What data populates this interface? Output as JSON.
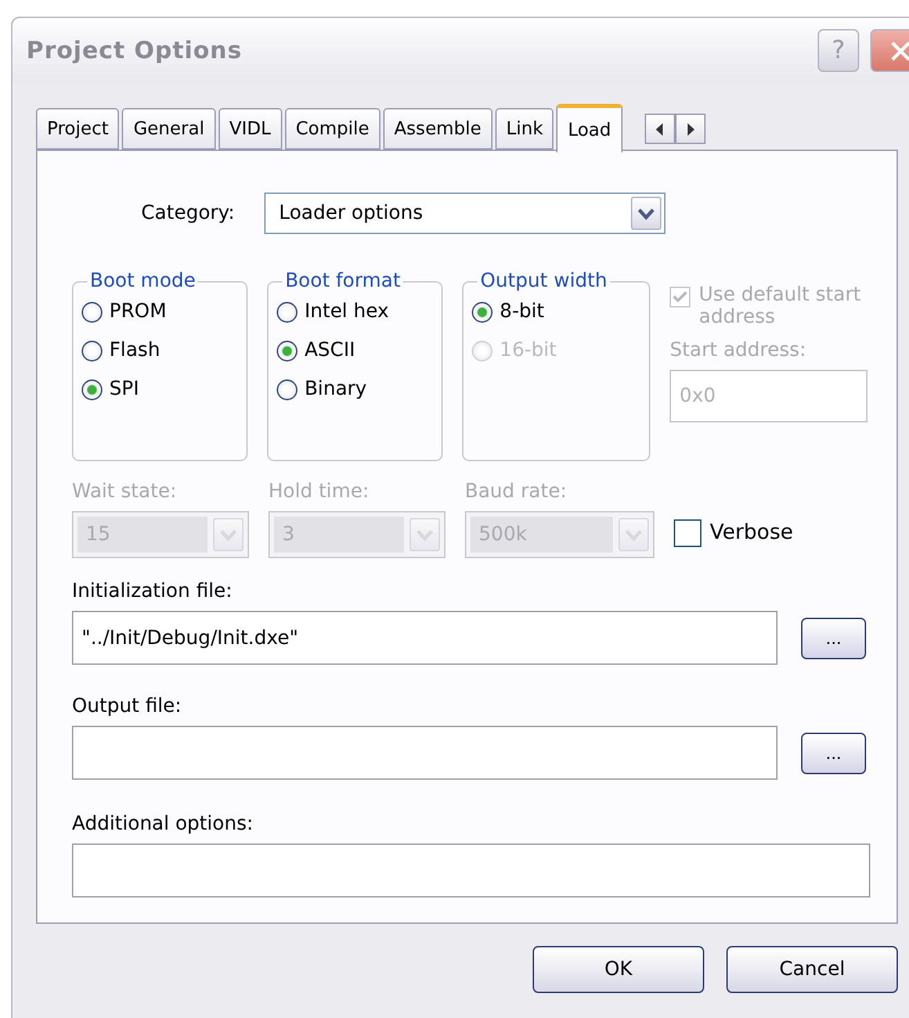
{
  "window": {
    "title": "Project Options"
  },
  "title_buttons": [
    {
      "kind": "help",
      "label": "?"
    },
    {
      "kind": "close"
    }
  ],
  "tabs": [
    {
      "label": "Project",
      "selected": false
    },
    {
      "label": "General",
      "selected": false
    },
    {
      "label": "VIDL",
      "selected": false
    },
    {
      "label": "Compile",
      "selected": false
    },
    {
      "label": "Assemble",
      "selected": false
    },
    {
      "label": "Link",
      "selected": false
    },
    {
      "label": "Load",
      "selected": true
    }
  ],
  "category": {
    "label": "Category:",
    "value": "Loader options"
  },
  "groups": [
    {
      "title": "Boot mode",
      "options": [
        {
          "label": "PROM",
          "selected": false,
          "disabled": false
        },
        {
          "label": "Flash",
          "selected": false,
          "disabled": false
        },
        {
          "label": "SPI",
          "selected": true,
          "disabled": false
        }
      ]
    },
    {
      "title": "Boot format",
      "options": [
        {
          "label": "Intel hex",
          "selected": false,
          "disabled": false
        },
        {
          "label": "ASCII",
          "selected": true,
          "disabled": false
        },
        {
          "label": "Binary",
          "selected": false,
          "disabled": false
        }
      ]
    },
    {
      "title": "Output width",
      "options": [
        {
          "label": "8-bit",
          "selected": true,
          "disabled": false
        },
        {
          "label": "16-bit",
          "selected": false,
          "disabled": true
        }
      ]
    }
  ],
  "use_default_start_address": {
    "label": "Use default start address",
    "checked": true,
    "disabled": true
  },
  "start_address": {
    "label": "Start address:",
    "value": "0x0",
    "disabled": true
  },
  "selects": [
    {
      "label": "Wait state:",
      "value": "15",
      "disabled": true
    },
    {
      "label": "Hold time:",
      "value": "3",
      "disabled": true
    },
    {
      "label": "Baud rate:",
      "value": "500k",
      "disabled": true
    }
  ],
  "verbose": {
    "label": "Verbose",
    "checked": false
  },
  "files": [
    {
      "label": "Initialization file:",
      "value": "\"../Init/Debug/Init.dxe\"",
      "browse": "..."
    },
    {
      "label": "Output file:",
      "browse": "..."
    }
  ],
  "additional_options": {
    "label": "Additional options:"
  },
  "buttons": [
    "OK",
    "Cancel"
  ]
}
